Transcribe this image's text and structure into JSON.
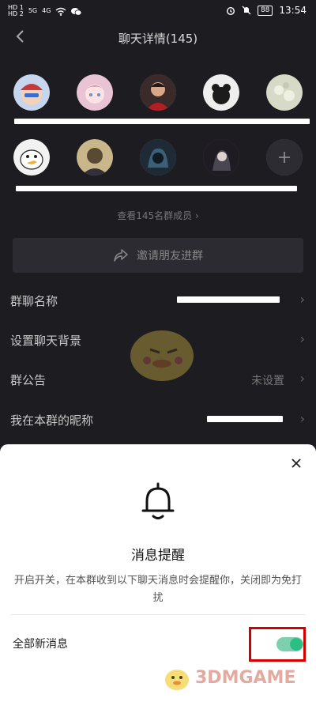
{
  "status_bar": {
    "left_labels": [
      "HD 1",
      "HD 2",
      "5G",
      "4G"
    ],
    "battery": "88",
    "time": "13:54"
  },
  "nav": {
    "title": "聊天详情(145)"
  },
  "more_members_label": "查看145名群成员",
  "invite_label": "邀请朋友进群",
  "settings": {
    "group_name_label": "群聊名称",
    "background_label": "设置聊天背景",
    "notice_label": "群公告",
    "notice_value": "未设置",
    "nickname_label": "我在本群的昵称"
  },
  "sheet": {
    "title": "消息提醒",
    "description": "开启开关，在本群收到以下聊天消息时会提醒你，关闭即为免打扰",
    "row_label": "全部新消息",
    "toggle_on": true
  },
  "watermark": {
    "text": "3DMGAME"
  },
  "colors": {
    "background": "#1c1c21",
    "toggle_on": "#2bbf83",
    "highlight_box": "#d40000"
  }
}
